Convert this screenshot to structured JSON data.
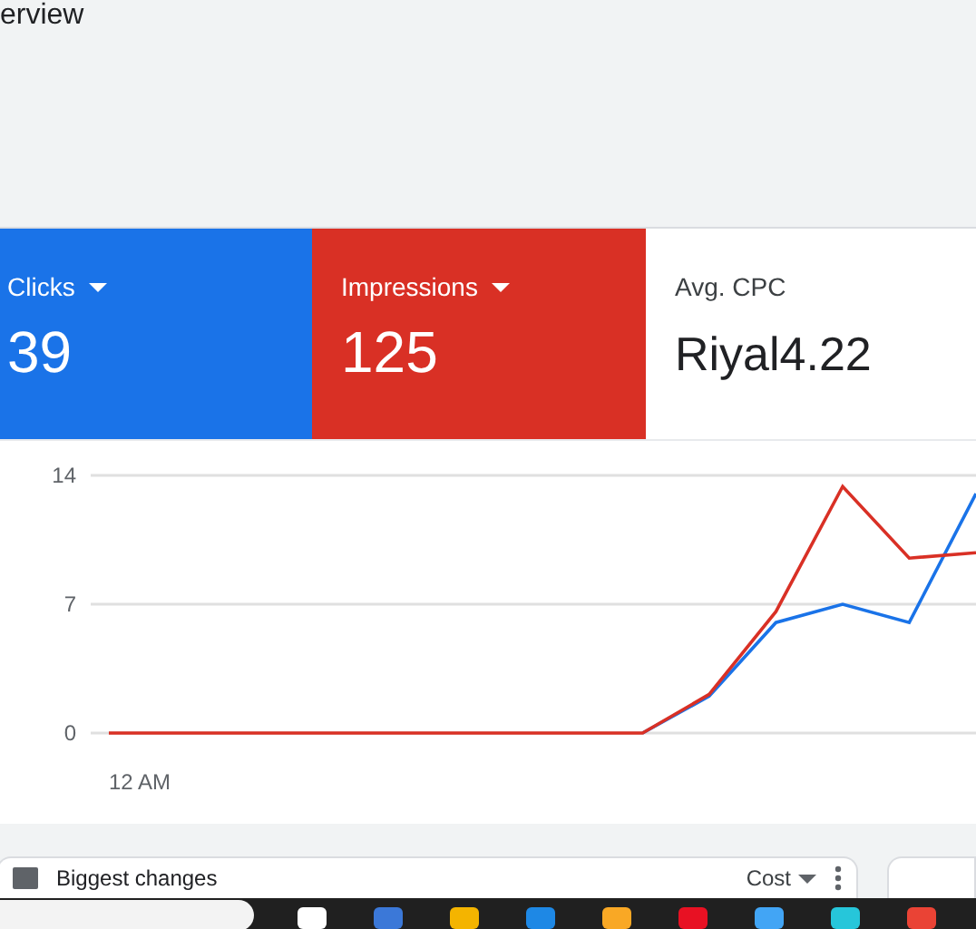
{
  "page_title": "erview",
  "metrics": [
    {
      "label": "Clicks",
      "value": "39",
      "selected": true,
      "color": "#1a73e8"
    },
    {
      "label": "Impressions",
      "value": "125",
      "selected": true,
      "color": "#d93025"
    },
    {
      "label": "Avg. CPC",
      "value": "Riyal4.22",
      "selected": false
    }
  ],
  "x_start_label": "12 AM",
  "chart_data": {
    "type": "line",
    "ylim": [
      0,
      14
    ],
    "yticks": [
      {
        "value": 0,
        "label": "0"
      },
      {
        "value": 7,
        "label": "7"
      },
      {
        "value": 14,
        "label": "14"
      }
    ],
    "series": [
      {
        "color": "#1a73e8",
        "values": [
          null,
          null,
          null,
          null,
          null,
          null,
          null,
          null,
          0,
          2,
          6,
          7,
          6,
          13
        ]
      },
      {
        "color": "#d93025",
        "values": [
          0,
          0,
          0,
          0,
          0,
          0,
          0,
          0,
          0,
          2.1,
          6.6,
          13.4,
          9.5,
          9.8
        ]
      }
    ]
  },
  "cards": [
    {
      "title": "Biggest changes",
      "dropdown": "Cost"
    }
  ]
}
